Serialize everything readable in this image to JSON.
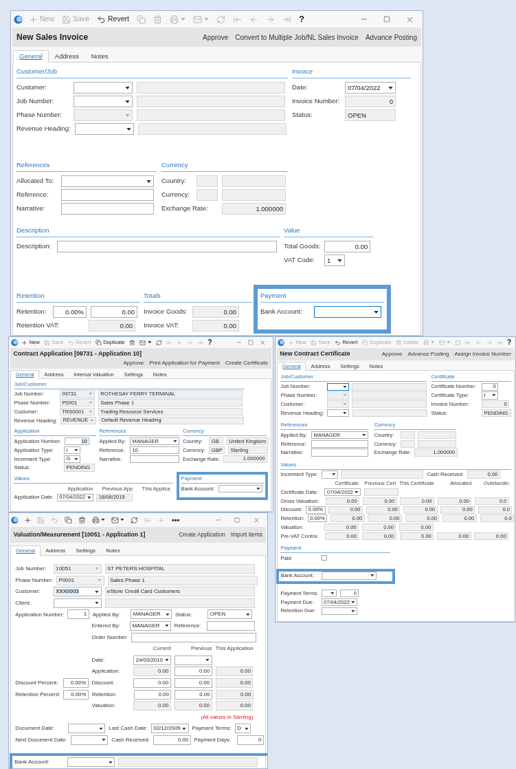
{
  "windows": [
    {
      "toolbar": [
        {
          "label": "New",
          "disabled": true
        },
        {
          "label": "Save",
          "disabled": true
        },
        {
          "label": "Revert",
          "disabled": false
        },
        {
          "disabled": true
        },
        {
          "disabled": true
        },
        {
          "disabled": true
        },
        {
          "disabled": true
        },
        {
          "disabled": true
        },
        {
          "disabled": true
        },
        {
          "disabled": true
        },
        {
          "disabled": true
        },
        {
          "disabled": true
        },
        {
          "label": "?",
          "disabled": false
        }
      ],
      "title": "New Sales Invoice",
      "actions": [
        "Approve",
        "Convert to Multiple Job/NL Sales Invoice",
        "Advance Posting"
      ],
      "tabs": [
        {
          "label": "General",
          "selected": true
        },
        {
          "label": "Address",
          "selected": false
        },
        {
          "label": "Notes",
          "selected": false
        }
      ],
      "sections": [
        {
          "title": "Customer/Job",
          "rows": [
            [
              {
                "kind": "label",
                "text": "Customer:"
              },
              {
                "kind": "combo",
                "readonly": false
              },
              {
                "kind": "text",
                "readonly": true
              }
            ],
            [
              {
                "kind": "label",
                "text": "Job Number:"
              },
              {
                "kind": "combo",
                "readonly": false
              },
              {
                "kind": "text",
                "readonly": true
              }
            ],
            [
              {
                "kind": "label",
                "text": "Phase Number:"
              },
              {
                "kind": "combo",
                "readonly": true
              },
              {
                "kind": "text",
                "readonly": true
              }
            ],
            [
              {
                "kind": "label",
                "text": "Revenue Heading:"
              },
              {
                "kind": "combo",
                "readonly": false
              },
              {
                "kind": "text",
                "readonly": true
              }
            ]
          ]
        },
        {
          "title": "Invoice",
          "rows": [
            [
              {
                "kind": "label",
                "text": "Date:"
              },
              {
                "kind": "combo",
                "readonly": false,
                "value": "07/04/2022"
              }
            ],
            [
              {
                "kind": "label",
                "text": "Invoice Number:"
              },
              {
                "kind": "number",
                "readonly": true,
                "value": "0"
              }
            ],
            [
              {
                "kind": "label",
                "text": "Status:"
              },
              {
                "kind": "text",
                "readonly": true,
                "value": "OPEN"
              }
            ]
          ]
        },
        {
          "title": "References",
          "rows": [
            [
              {
                "kind": "label",
                "text": "Allocated To:"
              },
              {
                "kind": "combo",
                "readonly": false
              }
            ],
            [
              {
                "kind": "label",
                "text": "Reference:"
              },
              {
                "kind": "text",
                "readonly": false
              }
            ],
            [
              {
                "kind": "label",
                "text": "Narrative:"
              },
              {
                "kind": "text",
                "readonly": false
              }
            ]
          ]
        },
        {
          "title": "Currency",
          "rows": [
            [
              {
                "kind": "label",
                "text": "Country:"
              },
              {
                "kind": "text",
                "readonly": true
              },
              {
                "kind": "text",
                "readonly": true
              }
            ],
            [
              {
                "kind": "label",
                "text": "Currency:"
              },
              {
                "kind": "text",
                "readonly": true
              },
              {
                "kind": "text",
                "readonly": true
              }
            ],
            [
              {
                "kind": "label",
                "text": "Exchange Rate:"
              },
              {
                "kind": "number",
                "readonly": true,
                "value": "1.000000"
              }
            ]
          ]
        },
        {
          "title": "Description",
          "rows": [
            [
              {
                "kind": "label",
                "text": "Description:"
              },
              {
                "kind": "text",
                "readonly": false
              }
            ]
          ]
        },
        {
          "title": "Value",
          "rows": [
            [
              {
                "kind": "label",
                "text": "Total Goods:"
              },
              {
                "kind": "number",
                "readonly": false,
                "value": "0.00"
              }
            ],
            [
              {
                "kind": "label",
                "text": "VAT Code:"
              },
              {
                "kind": "combo",
                "readonly": false,
                "value": "1"
              }
            ]
          ]
        },
        {
          "title": "Retention",
          "rows": [
            [
              {
                "kind": "label",
                "text": "Retention:"
              },
              {
                "kind": "number",
                "readonly": false,
                "value": "0.00%"
              },
              {
                "kind": "number",
                "readonly": false,
                "value": "0.00"
              }
            ],
            [
              {
                "kind": "label",
                "text": "Retention VAT:"
              },
              "",
              {
                "kind": "number",
                "readonly": true,
                "value": "0.00"
              }
            ]
          ]
        },
        {
          "title": "Totals",
          "rows": [
            [
              {
                "kind": "label",
                "text": "Invoice Goods:"
              },
              {
                "kind": "number",
                "readonly": true,
                "value": "0.00"
              }
            ],
            [
              {
                "kind": "label",
                "text": "Invoice VAT:"
              },
              {
                "kind": "number",
                "readonly": true,
                "value": "0.00"
              }
            ]
          ]
        },
        {
          "title": "Payment",
          "rows": [
            [
              {
                "kind": "label",
                "text": "Bank Account:"
              },
              {
                "kind": "combo",
                "readonly": false,
                "focused": true
              }
            ]
          ]
        }
      ]
    },
    {
      "toolbar": [
        {
          "label": "New",
          "disabled": false
        },
        {
          "label": "Save",
          "disabled": true
        },
        {
          "label": "Revert",
          "disabled": true
        },
        {
          "label": "Duplicate",
          "disabled": false
        },
        {
          "disabled": false
        },
        {
          "disabled": false
        },
        {
          "disabled": false
        },
        {
          "disabled": true
        },
        {
          "disabled": true
        },
        {
          "disabled": true
        },
        {
          "disabled": true
        },
        {
          "label": "?",
          "disabled": false
        }
      ],
      "title": "Contract Application [09731 - Application 10]",
      "actions": [
        "Approve",
        "Print Application for Payment",
        "Create Certificate"
      ],
      "tabs": [
        {
          "label": "General",
          "selected": true
        },
        {
          "label": "Address",
          "selected": false
        },
        {
          "label": "Internal Valuation",
          "selected": false
        },
        {
          "label": "Settings",
          "selected": false
        },
        {
          "label": "Notes",
          "selected": false
        }
      ],
      "sections": [
        {
          "title": "Job/Customer",
          "rows": [
            [
              {
                "kind": "label",
                "text": "Job Number:"
              },
              {
                "kind": "combo",
                "readonly": true,
                "value": "09731"
              },
              {
                "kind": "text",
                "readonly": true,
                "value": "ROTHESAY FERRY TERMINAL"
              }
            ],
            [
              {
                "kind": "label",
                "text": "Phase Number:"
              },
              {
                "kind": "combo",
                "readonly": true,
                "value": "P0001"
              },
              {
                "kind": "text",
                "readonly": true,
                "value": "Sales Phase 1"
              }
            ],
            [
              {
                "kind": "label",
                "text": "Customer:"
              },
              {
                "kind": "combo",
                "readonly": true,
                "value": "TRS0001"
              },
              {
                "kind": "text",
                "readonly": true,
                "value": "Trading Resource Services"
              }
            ],
            [
              {
                "kind": "label",
                "text": "Revenue Heading:"
              },
              {
                "kind": "combo",
                "readonly": true,
                "value": "REVENUE"
              },
              {
                "kind": "text",
                "readonly": true,
                "value": "Default Revenue Heading"
              }
            ]
          ]
        },
        {
          "title": "Application",
          "rows": [
            [
              {
                "kind": "label",
                "text": "Application Number:"
              },
              {
                "kind": "number",
                "readonly": false,
                "value": "10",
                "focused": true
              }
            ],
            [
              {
                "kind": "label",
                "text": "Application Type:"
              },
              {
                "kind": "combo",
                "readonly": false,
                "value": "I"
              }
            ],
            [
              {
                "kind": "label",
                "text": "Increment Type:"
              },
              {
                "kind": "combo",
                "readonly": false,
                "value": "G"
              }
            ],
            [
              {
                "kind": "label",
                "text": "Status:"
              },
              {
                "kind": "text",
                "readonly": true,
                "value": "PENDING"
              }
            ]
          ]
        },
        {
          "title": "References",
          "rows": [
            [
              {
                "kind": "label",
                "text": "Applied By:"
              },
              {
                "kind": "combo",
                "readonly": false,
                "value": "MANAGER"
              }
            ],
            [
              {
                "kind": "label",
                "text": "Reference:"
              },
              {
                "kind": "text",
                "readonly": false,
                "value": "10"
              }
            ],
            [
              {
                "kind": "label",
                "text": "Narrative:"
              },
              {
                "kind": "text",
                "readonly": false
              }
            ]
          ]
        },
        {
          "title": "Currency",
          "rows": [
            [
              {
                "kind": "label",
                "text": "Country:"
              },
              {
                "kind": "text",
                "readonly": true,
                "value": "GB"
              },
              {
                "kind": "text",
                "readonly": true,
                "value": "United Kingdom"
              }
            ],
            [
              {
                "kind": "label",
                "text": "Currency:"
              },
              {
                "kind": "text",
                "readonly": true,
                "value": "GBP"
              },
              {
                "kind": "text",
                "readonly": true,
                "value": "Sterling"
              }
            ],
            [
              {
                "kind": "label",
                "text": "Exchange Rate:"
              },
              {
                "kind": "number",
                "readonly": true,
                "value": "1.000000"
              }
            ]
          ]
        },
        {
          "title": "Values",
          "rows": [
            [
              "",
              {
                "kind": "heading",
                "text": "Application"
              },
              {
                "kind": "heading",
                "text": "Previous App"
              },
              {
                "kind": "heading",
                "text": "This Applica"
              }
            ],
            [
              {
                "kind": "label",
                "text": "Application Date:"
              },
              {
                "kind": "combo",
                "readonly": false,
                "value": "07/04/2022"
              },
              {
                "kind": "text",
                "readonly": true,
                "value": "18/06/2015"
              }
            ]
          ]
        },
        {
          "title": "Payment",
          "rows": [
            [
              {
                "kind": "label",
                "text": "Bank Account:"
              },
              {
                "kind": "combo",
                "readonly": false
              }
            ]
          ]
        }
      ]
    },
    {
      "toolbar": [
        {
          "label": "New",
          "disabled": true
        },
        {
          "label": "Save",
          "disabled": true
        },
        {
          "label": "Revert",
          "disabled": false
        },
        {
          "label": "Duplicate",
          "disabled": true
        },
        {
          "label": "Delete",
          "disabled": true
        },
        {
          "disabled": true
        },
        {
          "disabled": true
        },
        {
          "disabled": true
        },
        {
          "disabled": true
        },
        {
          "disabled": true
        },
        {
          "disabled": true
        },
        {
          "disabled": true
        },
        {
          "label": "?",
          "disabled": false
        }
      ],
      "title": "New Contract Certificate",
      "actions": [
        "Approve",
        "Advance Posting",
        "Assign Invoice Number"
      ],
      "tabs": [
        {
          "label": "General",
          "selected": true
        },
        {
          "label": "Address",
          "selected": false
        },
        {
          "label": "Settings",
          "selected": false
        },
        {
          "label": "Notes",
          "selected": false
        }
      ],
      "sections": [
        {
          "title": "Job/Customer",
          "rows": [
            [
              {
                "kind": "label",
                "text": "Job Number:"
              },
              {
                "kind": "combo",
                "readonly": false,
                "focused": true
              },
              {
                "kind": "text",
                "readonly": true
              }
            ],
            [
              {
                "kind": "label",
                "text": "Phase Number:"
              },
              {
                "kind": "combo",
                "readonly": true
              },
              {
                "kind": "text",
                "readonly": true
              }
            ],
            [
              {
                "kind": "label",
                "text": "Customer:"
              },
              {
                "kind": "combo",
                "readonly": true
              },
              {
                "kind": "text",
                "readonly": true
              }
            ],
            [
              {
                "kind": "label",
                "text": "Revenue Heading:"
              },
              {
                "kind": "combo",
                "readonly": false
              },
              {
                "kind": "text",
                "readonly": true
              }
            ]
          ]
        },
        {
          "title": "Certificate",
          "rows": [
            [
              {
                "kind": "label",
                "text": "Certificate Number:"
              },
              {
                "kind": "number",
                "readonly": false,
                "value": "0"
              }
            ],
            [
              {
                "kind": "label",
                "text": "Certificate Type:"
              },
              {
                "kind": "combo",
                "readonly": false,
                "value": "I"
              }
            ],
            [
              {
                "kind": "label",
                "text": "Invoice Number:"
              },
              {
                "kind": "number",
                "readonly": true,
                "value": "0"
              }
            ],
            [
              {
                "kind": "label",
                "text": "Status:"
              },
              {
                "kind": "text",
                "readonly": true,
                "value": "PENDING"
              }
            ]
          ]
        },
        {
          "title": "References",
          "rows": [
            [
              {
                "kind": "label",
                "text": "Applied By:"
              },
              {
                "kind": "combo",
                "readonly": false,
                "value": "MANAGER"
              }
            ],
            [
              {
                "kind": "label",
                "text": "Reference:"
              },
              {
                "kind": "text",
                "readonly": false
              }
            ],
            [
              {
                "kind": "label",
                "text": "Narrative:"
              },
              {
                "kind": "text",
                "readonly": false
              }
            ]
          ]
        },
        {
          "title": "Currency",
          "rows": [
            [
              {
                "kind": "label",
                "text": "Country:"
              },
              {
                "kind": "text",
                "readonly": true
              },
              {
                "kind": "text",
                "readonly": true
              }
            ],
            [
              {
                "kind": "label",
                "text": "Currency:"
              },
              {
                "kind": "text",
                "readonly": true
              },
              {
                "kind": "text",
                "readonly": true
              }
            ],
            [
              {
                "kind": "label",
                "text": "Exchange Rate:"
              },
              {
                "kind": "number",
                "readonly": true,
                "value": "1.000000"
              }
            ]
          ]
        },
        {
          "title": "Values",
          "rows": [
            [
              {
                "kind": "label",
                "text": "Increment Type:"
              },
              {
                "kind": "combo",
                "readonly": false
              },
              {
                "kind": "text",
                "readonly": true
              },
              {
                "kind": "label",
                "text": "Cash Received:"
              },
              {
                "kind": "number",
                "readonly": true,
                "value": "0.00"
              }
            ],
            [
              "",
              "",
              {
                "kind": "heading",
                "text": "Certificate"
              },
              {
                "kind": "heading",
                "text": "Previous Cert"
              },
              {
                "kind": "heading",
                "text": "This Certificate"
              },
              {
                "kind": "heading",
                "text": "Allocated"
              },
              {
                "kind": "heading",
                "text": "Outstandin"
              }
            ],
            [
              {
                "kind": "label",
                "text": "Certificate Date:"
              },
              "",
              {
                "kind": "combo",
                "readonly": false,
                "value": "07/04/2022"
              },
              {
                "kind": "text",
                "readonly": true
              }
            ],
            [
              {
                "kind": "label",
                "text": "Gross Valuation:"
              },
              "",
              {
                "kind": "number",
                "readonly": true,
                "value": "0.00"
              },
              {
                "kind": "number",
                "readonly": true,
                "value": "0.00"
              },
              {
                "kind": "number",
                "readonly": true,
                "value": "0.00"
              },
              {
                "kind": "number",
                "readonly": true,
                "value": "0.00"
              },
              {
                "kind": "number",
                "readonly": true,
                "value": "0.0"
              }
            ],
            [
              {
                "kind": "label",
                "text": "Discount:"
              },
              {
                "kind": "number",
                "readonly": false,
                "value": "0.00%"
              },
              {
                "kind": "number",
                "readonly": true,
                "value": "0.00"
              },
              {
                "kind": "number",
                "readonly": true,
                "value": "0.00"
              },
              {
                "kind": "number",
                "readonly": true,
                "value": "0.00"
              },
              {
                "kind": "number",
                "readonly": true,
                "value": "0.00"
              },
              {
                "kind": "number",
                "readonly": true,
                "value": "0.0"
              }
            ],
            [
              {
                "kind": "label",
                "text": "Retention:"
              },
              {
                "kind": "number",
                "readonly": false,
                "value": "0.00%"
              },
              {
                "kind": "number",
                "readonly": true,
                "value": "0.00"
              },
              {
                "kind": "number",
                "readonly": true,
                "value": "0.00"
              },
              {
                "kind": "number",
                "readonly": true,
                "value": "0.00"
              },
              {
                "kind": "number",
                "readonly": true,
                "value": "0.00"
              },
              {
                "kind": "number",
                "readonly": true,
                "value": "0.0"
              }
            ],
            [
              {
                "kind": "label",
                "text": "Valuation:"
              },
              "",
              {
                "kind": "number",
                "readonly": true,
                "value": "0.00"
              },
              {
                "kind": "number",
                "readonly": true,
                "value": "0.00"
              },
              {
                "kind": "number",
                "readonly": true,
                "value": "0.00"
              }
            ],
            [
              {
                "kind": "label",
                "text": "Pre-VAT Contra:"
              },
              "",
              {
                "kind": "number",
                "readonly": true,
                "value": "0.00"
              },
              {
                "kind": "number",
                "readonly": true,
                "value": "0.00"
              },
              {
                "kind": "number",
                "readonly": true,
                "value": "0.00"
              },
              {
                "kind": "number",
                "readonly": true,
                "value": "0.00"
              },
              {
                "kind": "number",
                "readonly": true,
                "value": "0.00"
              }
            ]
          ]
        },
        {
          "title": "Payment",
          "rows": [
            [
              {
                "kind": "label",
                "text": "Paid:"
              },
              {
                "kind": "check",
                "checked": false
              }
            ],
            [
              {
                "kind": "label",
                "text": "Bank Account:"
              },
              {
                "kind": "combo",
                "readonly": false
              }
            ],
            [
              {
                "kind": "label",
                "text": "Payment Terms:"
              },
              {
                "kind": "combo",
                "readonly": false
              },
              {
                "kind": "number",
                "readonly": false,
                "value": "0"
              }
            ],
            [
              {
                "kind": "label",
                "text": "Payment Due:"
              },
              {
                "kind": "combo",
                "readonly": false,
                "value": "07/04/2022"
              }
            ],
            [
              {
                "kind": "label",
                "text": "Retention Due:"
              },
              {
                "kind": "combo",
                "readonly": false
              }
            ]
          ]
        }
      ]
    },
    {
      "toolbar": [
        {
          "disabled": false
        },
        {
          "disabled": true
        },
        {
          "disabled": true
        },
        {
          "disabled": false
        },
        {
          "disabled": false
        },
        {
          "disabled": false
        },
        {
          "disabled": false
        },
        {
          "disabled": false
        },
        {
          "disabled": true
        },
        {
          "disabled": true
        },
        {
          "label": "•••",
          "disabled": false
        }
      ],
      "title": "Valuation/Measurement [10051 - Application 1]",
      "actions": [
        "Create Application",
        "Import Items"
      ],
      "tabs": [
        {
          "label": "General",
          "selected": true
        },
        {
          "label": "Address",
          "selected": false
        },
        {
          "label": "Settings",
          "selected": false
        },
        {
          "label": "Notes",
          "selected": false
        }
      ],
      "sections": [
        {
          "rows": [
            [
              {
                "kind": "label",
                "text": "Job Number:"
              },
              {
                "kind": "combo",
                "readonly": true,
                "value": "10051"
              },
              {
                "kind": "text",
                "readonly": true,
                "value": "ST PETERS HOSPITAL"
              }
            ],
            [
              {
                "kind": "label",
                "text": "Phase Number:"
              },
              {
                "kind": "combo",
                "readonly": true,
                "value": "P0001"
              },
              {
                "kind": "text",
                "readonly": true,
                "value": "Sales Phase 1"
              }
            ],
            [
              {
                "kind": "label",
                "text": "Customer:"
              },
              {
                "kind": "combo",
                "readonly": false,
                "value": "XXX0003",
                "focused": true
              },
              {
                "kind": "text",
                "readonly": true,
                "value": "eStore Credit Card Customers"
              }
            ],
            [
              {
                "kind": "label",
                "text": "Client:"
              },
              {
                "kind": "combo",
                "readonly": false
              },
              {
                "kind": "text",
                "readonly": true
              }
            ],
            [
              {
                "kind": "label",
                "text": "Application Number:"
              },
              {
                "kind": "number",
                "readonly": false,
                "value": "1"
              },
              {
                "kind": "label",
                "text": "Applied By:"
              },
              {
                "kind": "combo",
                "readonly": false,
                "value": "MANAGER"
              },
              {
                "kind": "label",
                "text": "Status:"
              },
              {
                "kind": "combo",
                "readonly": false,
                "value": "OPEN"
              }
            ],
            [
              "",
              "",
              {
                "kind": "label",
                "text": "Entered By:"
              },
              {
                "kind": "combo",
                "readonly": false,
                "value": "MANAGER"
              },
              {
                "kind": "label",
                "text": "Reference:"
              },
              {
                "kind": "text",
                "readonly": false
              }
            ],
            [
              "",
              "",
              {
                "kind": "label",
                "text": "Order Number:"
              },
              {
                "kind": "text",
                "readonly": false
              }
            ],
            [
              "",
              "",
              "",
              {
                "kind": "heading",
                "text": "Current"
              },
              {
                "kind": "heading",
                "text": "Previous"
              },
              {
                "kind": "heading",
                "text": "This Application"
              }
            ],
            [
              "",
              "",
              {
                "kind": "label",
                "text": "Date:"
              },
              {
                "kind": "combo",
                "readonly": false,
                "value": "24/03/2010"
              },
              {
                "kind": "combo",
                "readonly": false
              }
            ],
            [
              "",
              "",
              {
                "kind": "label",
                "text": "Application:"
              },
              {
                "kind": "number",
                "readonly": true,
                "value": "0.00"
              },
              {
                "kind": "number",
                "readonly": false,
                "value": "0.00"
              },
              {
                "kind": "number",
                "readonly": true,
                "value": "0.00"
              }
            ],
            [
              {
                "kind": "label",
                "text": "Discount Percent:"
              },
              {
                "kind": "number",
                "readonly": false,
                "value": "0.00%"
              },
              {
                "kind": "label",
                "text": "Discount:"
              },
              {
                "kind": "number",
                "readonly": false,
                "value": "0.00"
              },
              {
                "kind": "number",
                "readonly": false,
                "value": "0.00"
              },
              {
                "kind": "number",
                "readonly": true,
                "value": "0.00"
              }
            ],
            [
              {
                "kind": "label",
                "text": "Retention Percent:"
              },
              {
                "kind": "number",
                "readonly": false,
                "value": "0.00%"
              },
              {
                "kind": "label",
                "text": "Retention:"
              },
              {
                "kind": "number",
                "readonly": false,
                "value": "0.00"
              },
              {
                "kind": "number",
                "readonly": false,
                "value": "0.00"
              },
              {
                "kind": "number",
                "readonly": true,
                "value": "0.00"
              }
            ],
            [
              "",
              "",
              {
                "kind": "label",
                "text": "Valuation:"
              },
              {
                "kind": "number",
                "readonly": true,
                "value": "0.00"
              },
              {
                "kind": "number",
                "readonly": true,
                "value": "0.00"
              },
              {
                "kind": "number",
                "readonly": true,
                "value": "0.00"
              }
            ],
            [
              "",
              "",
              "",
              "",
              {
                "kind": "note",
                "text": "(All values in Sterling)"
              }
            ],
            [
              {
                "kind": "label",
                "text": "Document Date:"
              },
              {
                "kind": "combo",
                "readonly": false
              },
              {
                "kind": "label",
                "text": "Last Cash Date:"
              },
              {
                "kind": "combo",
                "readonly": false,
                "value": "02/12/2009"
              },
              {
                "kind": "label",
                "text": "Payment Terms:"
              },
              {
                "kind": "combo",
                "readonly": false,
                "value": "D"
              }
            ],
            [
              {
                "kind": "label",
                "text": "Next Document Date:"
              },
              {
                "kind": "combo",
                "readonly": false
              },
              {
                "kind": "label",
                "text": "Cash Received:"
              },
              {
                "kind": "number",
                "readonly": false,
                "value": "0.00"
              },
              {
                "kind": "label",
                "text": "Payment Days:"
              },
              {
                "kind": "number",
                "readonly": false,
                "value": "0"
              }
            ],
            [
              {
                "kind": "label",
                "text": "Bank Account:"
              },
              {
                "kind": "combo",
                "readonly": false
              },
              {
                "kind": "text",
                "readonly": true
              }
            ]
          ]
        }
      ]
    }
  ]
}
